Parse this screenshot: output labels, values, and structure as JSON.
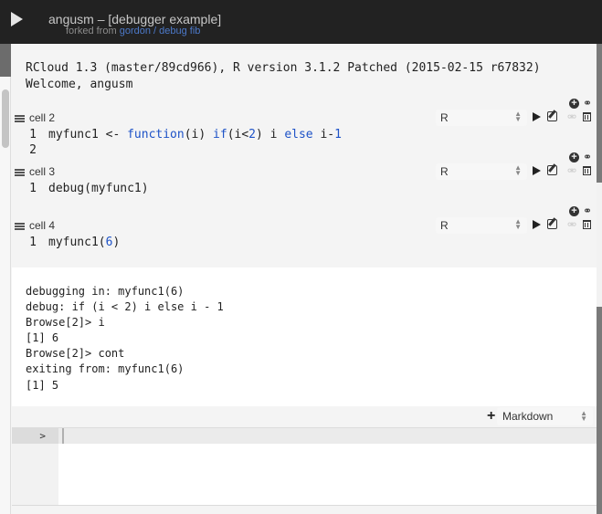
{
  "header": {
    "title": "angusm – [debugger example]",
    "forked_prefix": "forked from",
    "forked_link": "gordon / debug fib"
  },
  "welcome": {
    "line1": "RCloud 1.3 (master/89cd966), R version 3.1.2 Patched (2015-02-15 r67832)",
    "line2": "Welcome, angusm"
  },
  "cells": [
    {
      "label": "cell 2",
      "language": "R",
      "lines": [
        {
          "no": "1",
          "tokens": [
            {
              "text": "myfunc1 <- ",
              "kind": "plain"
            },
            {
              "text": "function",
              "kind": "kw"
            },
            {
              "text": "(i) ",
              "kind": "plain"
            },
            {
              "text": "if",
              "kind": "kw"
            },
            {
              "text": "(i<",
              "kind": "plain"
            },
            {
              "text": "2",
              "kind": "num"
            },
            {
              "text": ") i ",
              "kind": "plain"
            },
            {
              "text": "else",
              "kind": "kw"
            },
            {
              "text": " i-",
              "kind": "plain"
            },
            {
              "text": "1",
              "kind": "num"
            }
          ]
        },
        {
          "no": "2",
          "tokens": []
        }
      ]
    },
    {
      "label": "cell 3",
      "language": "R",
      "lines": [
        {
          "no": "1",
          "tokens": [
            {
              "text": "debug(myfunc1)",
              "kind": "plain"
            }
          ]
        }
      ]
    },
    {
      "label": "cell 4",
      "language": "R",
      "lines": [
        {
          "no": "1",
          "tokens": [
            {
              "text": "myfunc1(",
              "kind": "plain"
            },
            {
              "text": "6",
              "kind": "num"
            },
            {
              "text": ")",
              "kind": "plain"
            }
          ]
        }
      ]
    }
  ],
  "icons": {
    "run": "play-icon",
    "edit": "edit-icon",
    "insert": "plus-circle-icon",
    "join": "link-icon",
    "split": "unlink-icon",
    "delete": "trash-icon"
  },
  "output": {
    "lines": [
      "debugging in: myfunc1(6)",
      "debug: if (i < 2) i else i - 1",
      "Browse[2]> i",
      "[1] 6",
      "Browse[2]> cont",
      "exiting from: myfunc1(6)",
      "[1] 5"
    ]
  },
  "add_cell": {
    "plus": "+",
    "type": "Markdown"
  },
  "prompt": {
    "symbol": ">",
    "value": ""
  },
  "colors": {
    "topbar": "#222222",
    "keyword": "#1d52c7",
    "link": "#4c79c9"
  }
}
